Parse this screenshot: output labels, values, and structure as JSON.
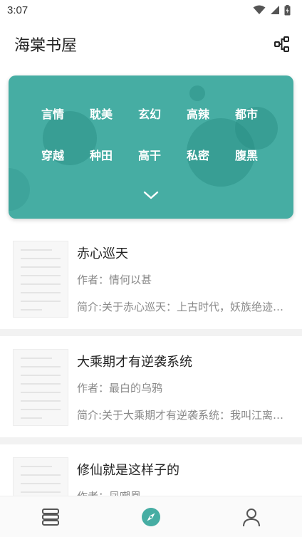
{
  "status_bar": {
    "time": "3:07"
  },
  "header": {
    "title": "海棠书屋",
    "share_icon": "share-nodes-icon"
  },
  "categories": {
    "items": [
      "言情",
      "耽美",
      "玄幻",
      "高辣",
      "都市",
      "穿越",
      "种田",
      "高干",
      "私密",
      "腹黑"
    ],
    "expand_icon": "chevron-down-icon",
    "color": "#46ada3"
  },
  "books": [
    {
      "title": "赤心巡天",
      "author": "作者：情何以甚",
      "intro": "简介:关于赤心巡天：上古时代，妖族绝迹…"
    },
    {
      "title": "大乘期才有逆袭系统",
      "author": "作者：最白的乌鸦",
      "intro": "简介:关于大乘期才有逆袭系统：我叫江离…"
    },
    {
      "title": "修仙就是这样子的",
      "author": "作者：凤嘲凰",
      "intro": ""
    }
  ],
  "bottom_nav": {
    "items": [
      "bookshelf-icon",
      "compass-icon",
      "user-icon"
    ],
    "active_color": "#46ada3"
  }
}
